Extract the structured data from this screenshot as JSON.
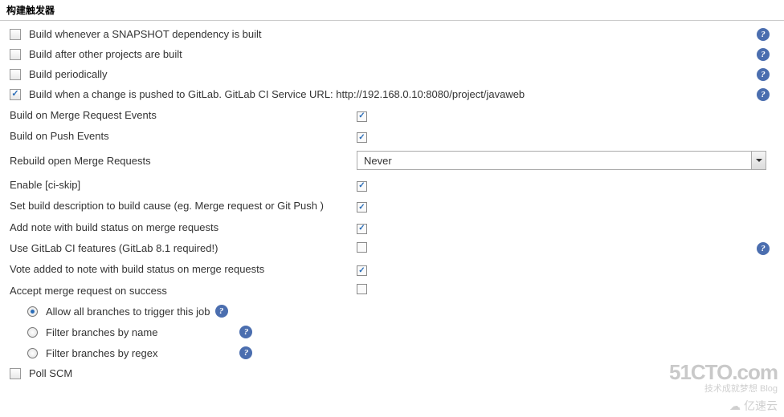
{
  "section_title": "构建触发器",
  "triggers": {
    "snapshot": {
      "label": "Build whenever a SNAPSHOT dependency is built",
      "checked": false
    },
    "after_projects": {
      "label": "Build after other projects are built",
      "checked": false
    },
    "periodically": {
      "label": "Build periodically",
      "checked": false
    },
    "gitlab": {
      "label": "Build when a change is pushed to GitLab. GitLab CI Service URL: http://192.168.0.10:8080/project/javaweb",
      "checked": true
    },
    "poll_scm": {
      "label": "Poll SCM",
      "checked": false
    }
  },
  "gitlab_opts": {
    "merge_request_events": {
      "label": "Build on Merge Request Events",
      "checked": true
    },
    "push_events": {
      "label": "Build on Push Events",
      "checked": true
    },
    "rebuild_open_mr": {
      "label": "Rebuild open Merge Requests",
      "value": "Never"
    },
    "ci_skip": {
      "label": "Enable [ci-skip]",
      "checked": true
    },
    "build_desc": {
      "label": "Set build description to build cause (eg. Merge request or Git Push )",
      "checked": true
    },
    "add_note": {
      "label": "Add note with build status on merge requests",
      "checked": true
    },
    "gitlab_ci_features": {
      "label": "Use GitLab CI features (GitLab 8.1 required!)",
      "checked": false
    },
    "vote_note": {
      "label": "Vote added to note with build status on merge requests",
      "checked": true
    },
    "accept_mr": {
      "label": "Accept merge request on success",
      "checked": false
    }
  },
  "branch_filter": {
    "selected": "all",
    "all": "Allow all branches to trigger this job",
    "by_name": "Filter branches by name",
    "by_regex": "Filter branches by regex"
  },
  "watermark": {
    "main": "51CTO.com",
    "sub": "技术成就梦想  Blog",
    "cloud": "亿速云"
  }
}
